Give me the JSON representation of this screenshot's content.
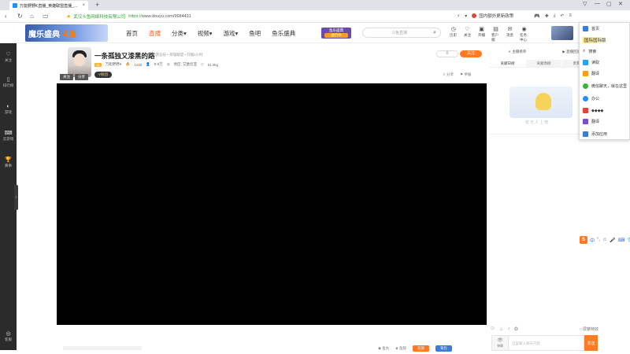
{
  "browser": {
    "tab_title": "万能野野K直播_英雄联盟直播_斗鱼",
    "tab_close": "×",
    "new_tab": "+",
    "window_controls": [
      "▽",
      "—",
      "▢",
      "✕"
    ],
    "site_name": "武汉斗鱼网络科技有限公司",
    "url_scheme": "https://",
    "url_host": "www.douyu.com",
    "url_path": "/9684431",
    "search_engine_text": "国内额外更新政策",
    "nav_icons": [
      "back-icon",
      "refresh-icon",
      "home-icon",
      "tabs-icon"
    ]
  },
  "site": {
    "logo_text": "魔乐盛典",
    "logo_brand": "斗鱼",
    "nav": [
      {
        "label": "首页",
        "active": false
      },
      {
        "label": "直播",
        "active": true
      },
      {
        "label": "分类▾",
        "active": false
      },
      {
        "label": "视频▾",
        "active": false
      },
      {
        "label": "游戏▾",
        "active": false
      },
      {
        "label": "鱼吧",
        "active": false
      },
      {
        "label": "鱼乐盛典",
        "active": false
      }
    ],
    "promo_line1": "鱼乐盛典",
    "promo_line2": "进行中",
    "search_placeholder": "斗鱼直播",
    "user_icons": [
      {
        "label": "历史",
        "glyph": "◷"
      },
      {
        "label": "关注",
        "glyph": "♡"
      },
      {
        "label": "开播",
        "glyph": "▣"
      },
      {
        "label": "客户端",
        "glyph": "▤"
      },
      {
        "label": "消息",
        "glyph": "✉"
      },
      {
        "label": "任务中心",
        "glyph": "◉"
      }
    ]
  },
  "sidebar": {
    "items": [
      {
        "label": "关注",
        "glyph": "♡"
      },
      {
        "label": "排行榜",
        "glyph": "▯"
      },
      {
        "label": "游戏",
        "glyph": "◐"
      },
      {
        "label": "云游戏",
        "glyph": "⌨"
      },
      {
        "label": "赛事",
        "glyph": "🏆"
      },
      {
        "label": "客服",
        "glyph": "◎"
      }
    ],
    "handle": "›"
  },
  "room": {
    "avatar_btns": [
      "关注",
      "分享"
    ],
    "title": "一条孤独又漆黑的路",
    "tags": "网游竞技 • 英雄联盟 • 开播1小时",
    "level": "11",
    "anchor_name": "万能野野K",
    "hot": "1440",
    "followers": "8.9万",
    "region": "地区: 艾欧尼亚",
    "weight": "51.0kg",
    "vip": "V粉团",
    "follow_count_btn": "0",
    "follow_btn": "关注",
    "share": "分享",
    "report": "举报"
  },
  "player_bottom": {
    "items": [
      "鱼丸",
      "鱼翅"
    ],
    "btn1": "充值",
    "btn2": "背包"
  },
  "right_panel": {
    "anchor_tab": "主播榜单",
    "live_tab": "直播回放",
    "tabs": [
      "贡献日榜",
      "贡献周榜",
      "贵宾列表"
    ],
    "empty_text": "暂无人上榜",
    "block_label": "屏蔽特效",
    "chat_left_label": "弹幕",
    "chat_placeholder": "这里输入聊天内容",
    "send": "发送",
    "tool_icons": [
      "☺",
      "♨",
      "♪",
      "✿"
    ]
  },
  "popup": {
    "top_label": "首页",
    "header": "国际国际版",
    "items": [
      {
        "label": "搜索",
        "color": "#3d7bd9"
      },
      {
        "label": "读取",
        "color": "#2aa0f0"
      },
      {
        "label": "翻译",
        "color": "#ff9d1a"
      },
      {
        "label": "微信聊天，就在这里",
        "color": "#34b334"
      },
      {
        "label": "办公",
        "color": "#1e90ff"
      },
      {
        "label": "◆◆◆◆",
        "color": "#e8433a"
      },
      {
        "label": "翻译",
        "color": "#7b4ad9"
      },
      {
        "label": "添加应用",
        "color": "#3d7bd9"
      }
    ]
  },
  "ime": {
    "logo": "S",
    "items": [
      "中",
      "°,",
      "☺",
      "🎤",
      "⌨",
      "👕",
      "▦"
    ]
  }
}
